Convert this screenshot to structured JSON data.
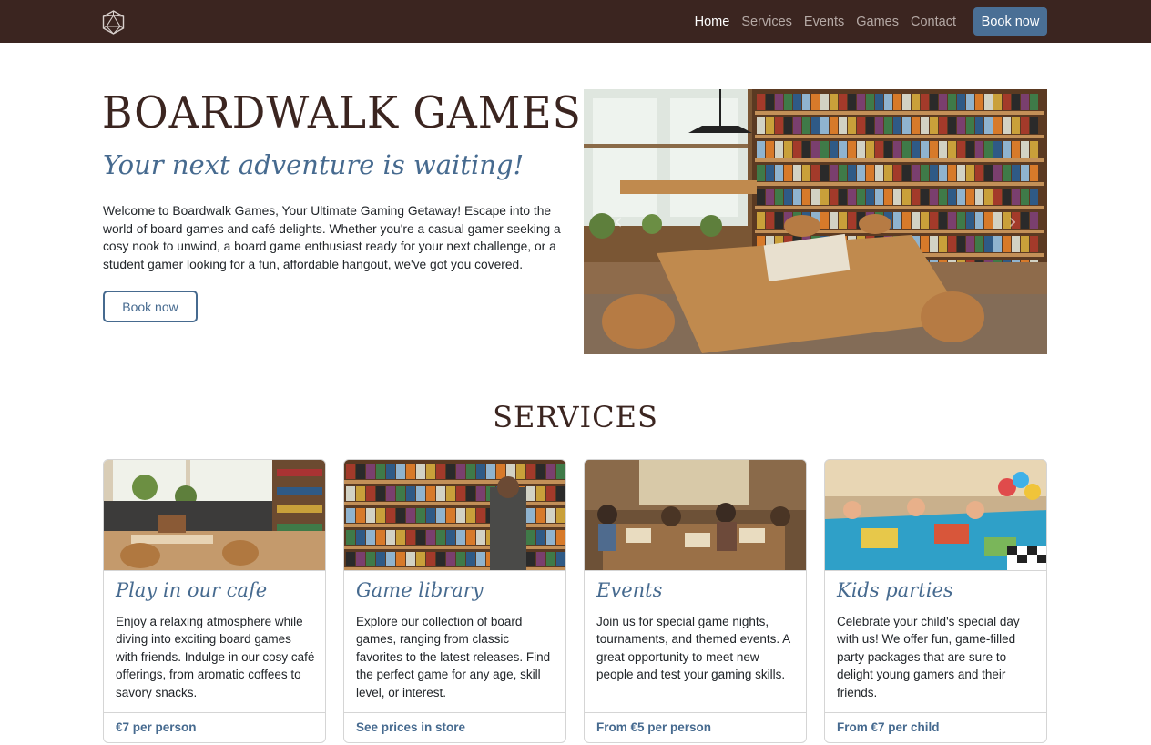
{
  "nav": {
    "logo_icon": "d20-dice-icon",
    "links": [
      {
        "label": "Home",
        "active": true
      },
      {
        "label": "Services",
        "active": false
      },
      {
        "label": "Events",
        "active": false
      },
      {
        "label": "Games",
        "active": false
      },
      {
        "label": "Contact",
        "active": false
      }
    ],
    "cta_label": "Book now"
  },
  "hero": {
    "title": "BOARDWALK GAMES",
    "subtitle": "Your next adventure is waiting!",
    "text": "Welcome to Boardwalk Games, Your Ultimate Gaming Getaway! Escape into the world of board games and café delights. Whether you're a casual gamer seeking a cosy nook to unwind, a board game enthusiast ready for your next challenge, or a student gamer looking for a fun, affordable hangout, we've got you covered.",
    "button_label": "Book now",
    "carousel_prev_icon": "chevron-left-icon",
    "carousel_next_icon": "chevron-right-icon"
  },
  "services": {
    "title": "SERVICES",
    "cards": [
      {
        "title": "Play in our cafe",
        "text": "Enjoy a relaxing atmosphere while diving into exciting board games with friends. Indulge in our cosy café offerings, from aromatic coffees to savory snacks.",
        "price": "€7 per person"
      },
      {
        "title": "Game library",
        "text": "Explore our collection of board games, ranging from classic favorites to the latest releases. Find the perfect game for any age, skill level, or interest.",
        "price": "See prices in store"
      },
      {
        "title": "Events",
        "text": "Join us for special game nights, tournaments, and themed events. A great opportunity to meet new people and test your gaming skills.",
        "price": "From €5 per person"
      },
      {
        "title": "Kids parties",
        "text": "Celebrate your child's special day with us! We offer fun, game-filled party packages that are sure to delight young gamers and their friends.",
        "price": "From €7 per child"
      }
    ]
  },
  "colors": {
    "nav_bg": "#3b2520",
    "brand_brown": "#3b2520",
    "accent_blue": "#466a8f",
    "button_blue": "#4a6f95"
  }
}
